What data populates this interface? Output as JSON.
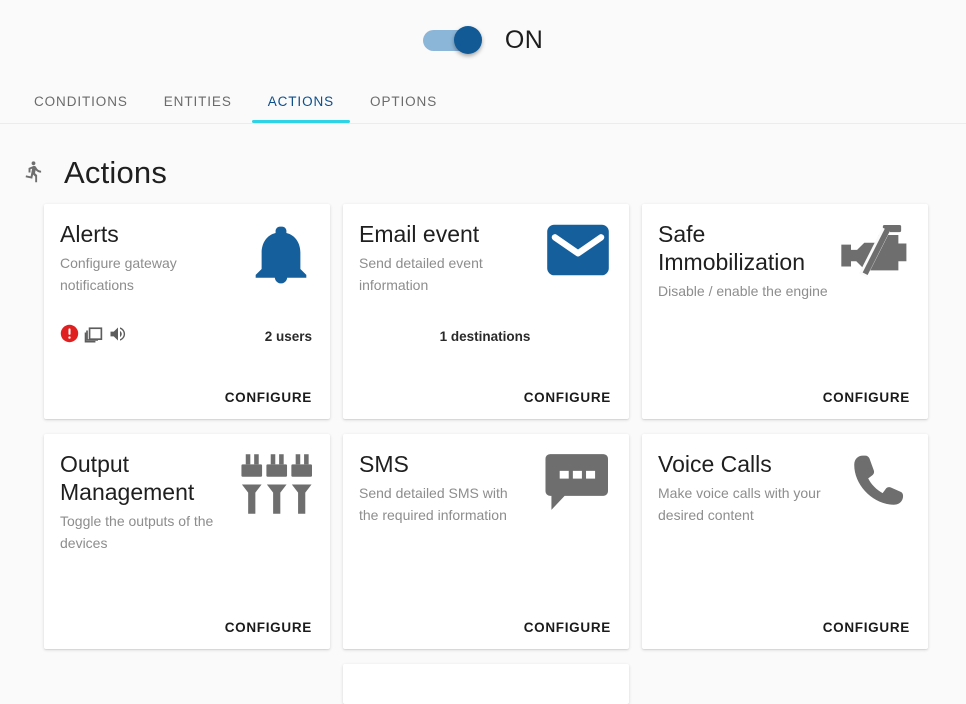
{
  "header": {
    "toggle": {
      "name": "enable-toggle",
      "state": "on",
      "label": "ON"
    }
  },
  "tabs": [
    {
      "id": "conditions",
      "label": "CONDITIONS",
      "active": false
    },
    {
      "id": "entities",
      "label": "ENTITIES",
      "active": false
    },
    {
      "id": "actions",
      "label": "ACTIONS",
      "active": true
    },
    {
      "id": "options",
      "label": "OPTIONS",
      "active": false
    }
  ],
  "page": {
    "title": "Actions",
    "icon": "running-person-icon"
  },
  "colors": {
    "accent_blue": "#15609c",
    "tab_active": "#0d4f8b",
    "tab_underline": "#2ed4e6",
    "icon_gray": "#6e6e6e",
    "alert_red": "#e02020",
    "background": "#fafafa",
    "card": "#ffffff"
  },
  "cards": [
    {
      "id": "alerts",
      "title": "Alerts",
      "subtitle": "Configure gateway notifications",
      "icon": "bell-icon",
      "icon_color": "#15609c",
      "meta_icons": [
        "alert-circle-icon",
        "window-copy-icon",
        "speaker-icon"
      ],
      "count": "2 users",
      "count_align": "right",
      "action": "CONFIGURE"
    },
    {
      "id": "email-event",
      "title": "Email event",
      "subtitle": "Send detailed event information",
      "icon": "envelope-icon",
      "icon_color": "#15609c",
      "meta_icons": [],
      "count": "1 destinations",
      "count_align": "center",
      "action": "CONFIGURE"
    },
    {
      "id": "safe-immobilization",
      "title": "Safe Immobilization",
      "subtitle": "Disable / enable the engine",
      "icon": "engine-off-icon",
      "icon_color": "#6e6e6e",
      "meta_icons": [],
      "count": "",
      "count_align": "right",
      "action": "CONFIGURE"
    },
    {
      "id": "output-management",
      "title": "Output Management",
      "subtitle": "Toggle the outputs of the devices",
      "icon": "power-plugs-icon",
      "icon_color": "#6e6e6e",
      "meta_icons": [],
      "count": "",
      "count_align": "right",
      "action": "CONFIGURE"
    },
    {
      "id": "sms",
      "title": "SMS",
      "subtitle": "Send detailed SMS with the required information",
      "icon": "chat-bubble-icon",
      "icon_color": "#6e6e6e",
      "meta_icons": [],
      "count": "",
      "count_align": "right",
      "action": "CONFIGURE"
    },
    {
      "id": "voice-calls",
      "title": "Voice Calls",
      "subtitle": "Make voice calls with your desired content",
      "icon": "phone-icon",
      "icon_color": "#6e6e6e",
      "meta_icons": [],
      "count": "",
      "count_align": "right",
      "action": "CONFIGURE"
    }
  ]
}
